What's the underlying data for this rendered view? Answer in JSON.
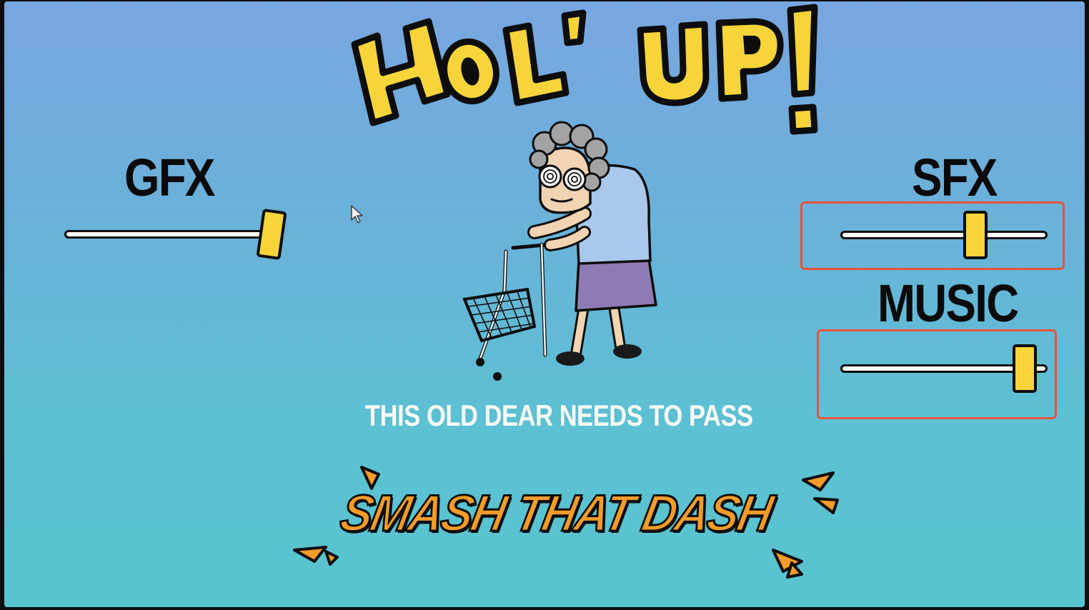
{
  "title": "HOL' UP!",
  "settings": {
    "gfx": {
      "label": "GFX",
      "value": 1.0
    },
    "sfx": {
      "label": "SFX",
      "value": 0.65
    },
    "music": {
      "label": "MUSIC",
      "value": 0.89
    }
  },
  "subtitle": "THIS OLD DEAR NEEDS TO PASS",
  "action_button": "SMASH THAT DASH",
  "colors": {
    "title_yellow": "#f7d43a",
    "button_orange": "#f39c2a",
    "highlight_red": "#e8533a"
  }
}
